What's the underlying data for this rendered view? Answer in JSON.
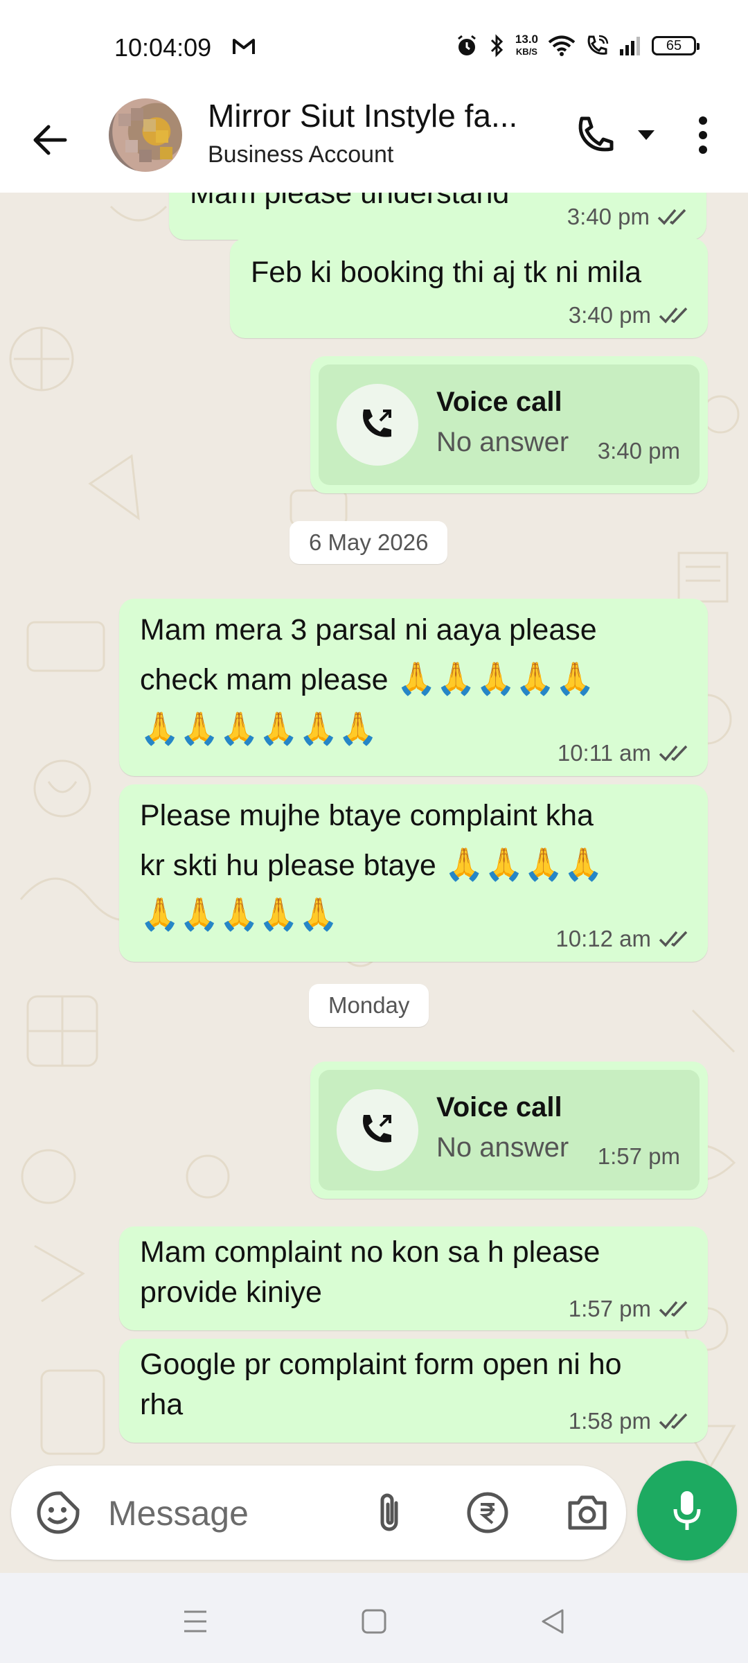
{
  "status_bar": {
    "time": "10:04:09",
    "net_speed_value": "13.0",
    "net_speed_unit": "KB/S",
    "battery": "65"
  },
  "header": {
    "contact_name": "Mirror Siut Instyle fa...",
    "subtitle": "Business Account"
  },
  "messages": [
    {
      "type": "text",
      "text": "Mam please understand",
      "time": "3:40 pm"
    },
    {
      "type": "text",
      "text": "Feb ki booking thi aj tk ni mila",
      "time": "3:40 pm"
    },
    {
      "type": "call",
      "title": "Voice call",
      "status": "No answer",
      "time": "3:40 pm"
    },
    {
      "type": "date",
      "text": "6 May 2026"
    },
    {
      "type": "text",
      "line1": "Mam mera 3 parsal ni aaya please",
      "line2": "check mam please",
      "time": "10:11 am",
      "emoji": "🙏"
    },
    {
      "type": "text",
      "line1": "Please mujhe btaye complaint kha",
      "line2": "kr skti hu please btaye",
      "time": "10:12 am",
      "emoji": "🙏"
    },
    {
      "type": "date",
      "text": "Monday"
    },
    {
      "type": "call",
      "title": "Voice call",
      "status": "No answer",
      "time": "1:57 pm"
    },
    {
      "type": "text",
      "line1": "Mam complaint no kon sa h please",
      "line2": "provide kiniye",
      "time": "1:57 pm"
    },
    {
      "type": "text",
      "line1": "Google pr complaint form open ni ho",
      "line2": "rha",
      "time": "1:58 pm"
    }
  ],
  "input": {
    "placeholder": "Message"
  },
  "colors": {
    "outgoing_bubble": "#d9fdd3",
    "chat_bg": "#efeae2",
    "accent": "#1daa61",
    "tick": "#555555"
  },
  "icons": [
    "back-arrow-icon",
    "phone-icon",
    "chevron-down-icon",
    "more-vert-icon",
    "outgoing-call-icon",
    "double-check-icon",
    "sticker-icon",
    "attach-icon",
    "rupee-icon",
    "camera-icon",
    "mic-icon",
    "menu-icon",
    "home-icon",
    "back-nav-icon",
    "gmail-icon",
    "alarm-icon",
    "bluetooth-icon",
    "wifi-icon",
    "wifi-call-icon",
    "signal-icon"
  ]
}
